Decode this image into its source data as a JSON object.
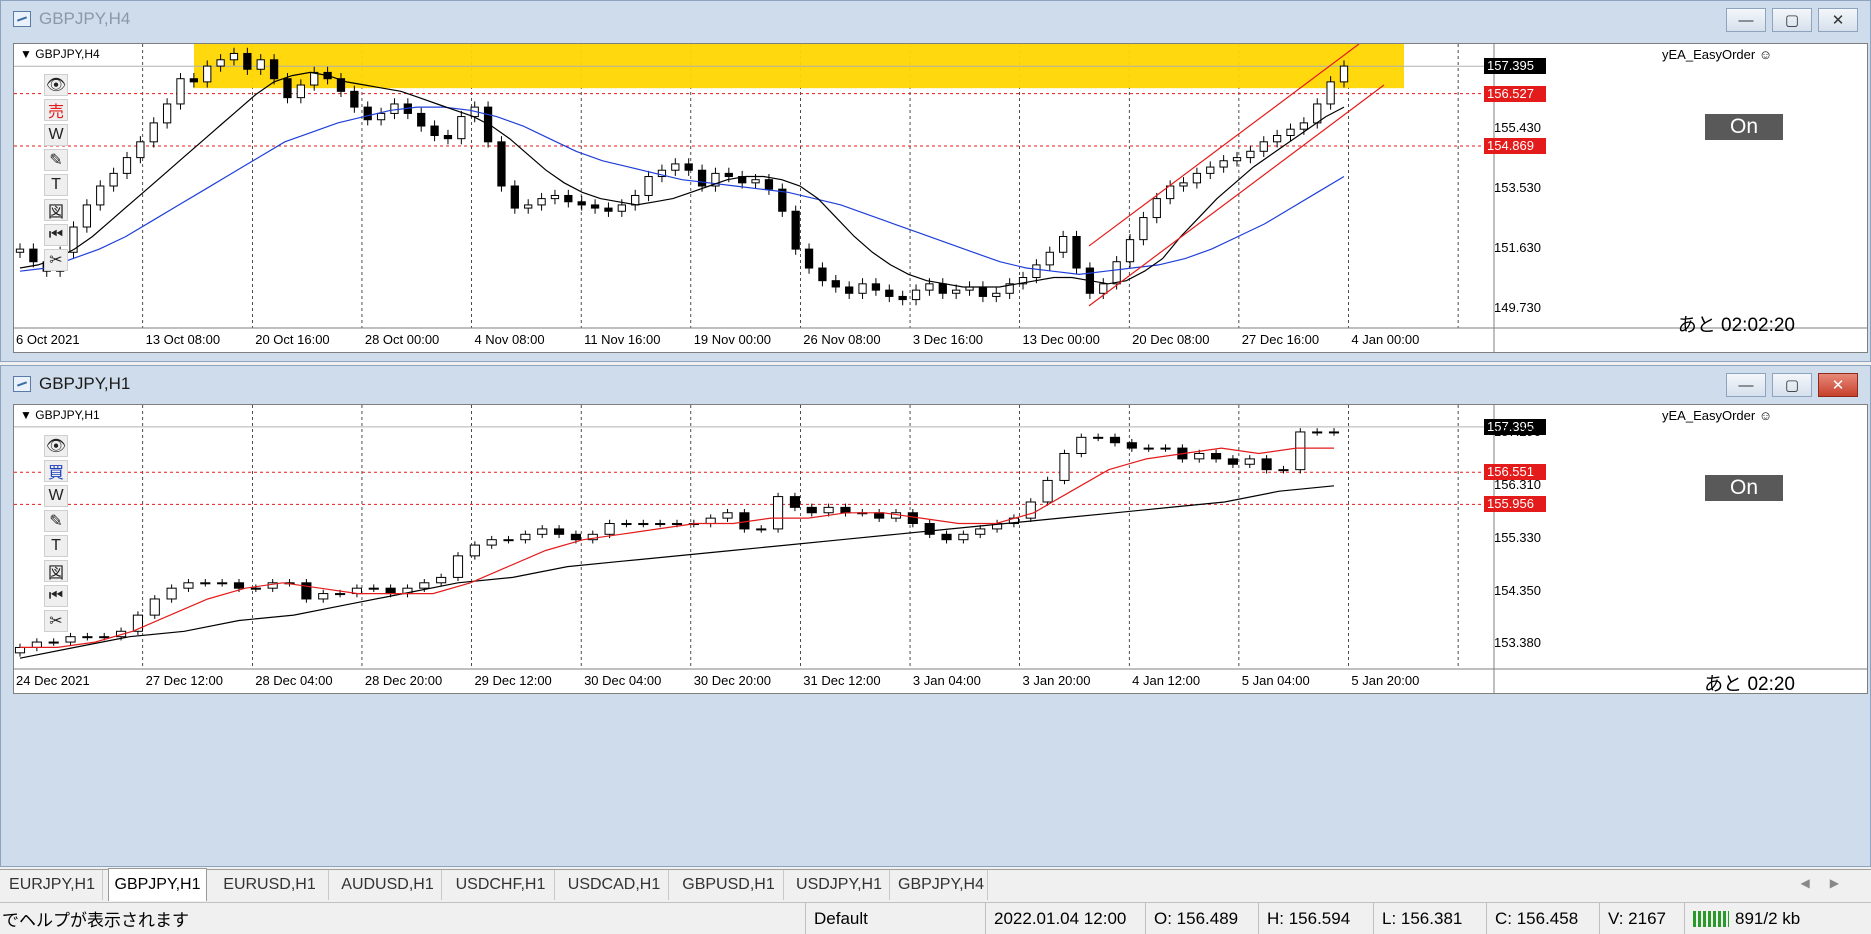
{
  "windows": [
    {
      "id": "h4",
      "title": "GBPJPY,H4",
      "symbol_label": "GBPJPY,H4",
      "ea_label": "yEA_EasyOrder",
      "order_tool_label": "売",
      "order_tool_color": "#e31b1b",
      "on_label": "On",
      "countdown": "あと 02:02:20",
      "price_labels": [
        "157.395",
        "156.527",
        "155.430",
        "154.869",
        "153.530",
        "151.630",
        "149.730"
      ],
      "current_price": "157.395",
      "red_lines": [
        "156.527",
        "154.869"
      ],
      "time_labels": [
        "6 Oct 2021",
        "13 Oct 08:00",
        "20 Oct 16:00",
        "28 Oct 00:00",
        "4 Nov 08:00",
        "11 Nov 16:00",
        "19 Nov 00:00",
        "26 Nov 08:00",
        "3 Dec 16:00",
        "13 Dec 00:00",
        "20 Dec 08:00",
        "27 Dec 16:00",
        "4 Jan 00:00"
      ],
      "chart_data": {
        "type": "candlestick",
        "ylim": [
          149.1,
          158.1
        ],
        "close": [
          151.6,
          151.2,
          150.9,
          151.5,
          152.3,
          153.0,
          153.6,
          154.0,
          154.5,
          155.0,
          155.6,
          156.2,
          157.0,
          156.9,
          157.4,
          157.6,
          157.8,
          157.3,
          157.6,
          157.0,
          156.4,
          156.8,
          157.2,
          157.0,
          156.6,
          156.1,
          155.7,
          155.9,
          156.2,
          155.9,
          155.5,
          155.2,
          155.1,
          155.8,
          156.1,
          155.0,
          153.6,
          152.9,
          153.0,
          153.2,
          153.3,
          153.1,
          153.0,
          152.9,
          152.8,
          153.0,
          153.3,
          153.9,
          154.1,
          154.3,
          154.1,
          153.6,
          154.0,
          153.9,
          153.7,
          153.8,
          153.5,
          152.8,
          151.6,
          151.0,
          150.6,
          150.4,
          150.2,
          150.5,
          150.3,
          150.1,
          150.0,
          150.3,
          150.5,
          150.2,
          150.3,
          150.4,
          150.1,
          150.2,
          150.5,
          150.7,
          151.1,
          151.5,
          152.0,
          151.0,
          150.2,
          150.5,
          151.2,
          151.9,
          152.6,
          153.2,
          153.6,
          153.7,
          154.0,
          154.2,
          154.4,
          154.5,
          154.7,
          155.0,
          155.2,
          155.4,
          155.6,
          156.2,
          156.9,
          157.4
        ],
        "ma_short": [
          151.0,
          151.1,
          151.3,
          151.6,
          152.0,
          152.5,
          153.0,
          153.5,
          154.0,
          154.5,
          155.0,
          155.5,
          156.0,
          156.5,
          156.9,
          157.1,
          157.2,
          157.1,
          156.9,
          156.8,
          156.7,
          156.6,
          156.4,
          156.2,
          156.0,
          155.8,
          155.5,
          155.1,
          154.6,
          154.1,
          153.7,
          153.4,
          153.2,
          153.1,
          153.0,
          153.1,
          153.2,
          153.4,
          153.6,
          153.8,
          153.9,
          153.9,
          153.8,
          153.6,
          153.2,
          152.6,
          152.0,
          151.5,
          151.1,
          150.8,
          150.6,
          150.5,
          150.4,
          150.4,
          150.4,
          150.5,
          150.6,
          150.7,
          150.7,
          150.6,
          150.5,
          150.6,
          150.9,
          151.3,
          152.0,
          152.6,
          153.2,
          153.7,
          154.2,
          154.6,
          155.0,
          155.4,
          155.8,
          156.1
        ],
        "ma_long": [
          150.9,
          151.0,
          151.3,
          151.6,
          152.0,
          152.5,
          153.0,
          153.5,
          154.0,
          154.5,
          155.0,
          155.3,
          155.6,
          155.8,
          156.0,
          156.1,
          156.1,
          156.0,
          155.8,
          155.5,
          155.1,
          154.7,
          154.4,
          154.2,
          154.0,
          153.8,
          153.7,
          153.6,
          153.5,
          153.4,
          153.2,
          153.0,
          152.7,
          152.4,
          152.1,
          151.8,
          151.5,
          151.2,
          151.0,
          150.9,
          150.8,
          150.9,
          151.0,
          151.1,
          151.3,
          151.6,
          152.0,
          152.4,
          152.9,
          153.4,
          153.9
        ]
      }
    },
    {
      "id": "h1",
      "title": "GBPJPY,H1",
      "symbol_label": "GBPJPY,H1",
      "ea_label": "yEA_EasyOrder",
      "order_tool_label": "買",
      "order_tool_color": "#1f3fbf",
      "on_label": "On",
      "countdown": "あと 02:20",
      "price_labels": [
        "157.395",
        "157.290",
        "156.551",
        "156.310",
        "155.956",
        "155.330",
        "154.350",
        "153.380"
      ],
      "current_price": "157.395",
      "red_lines": [
        "156.551",
        "155.956"
      ],
      "time_labels": [
        "24 Dec 2021",
        "27 Dec 12:00",
        "28 Dec 04:00",
        "28 Dec 20:00",
        "29 Dec 12:00",
        "30 Dec 04:00",
        "30 Dec 20:00",
        "31 Dec 12:00",
        "3 Jan 04:00",
        "3 Jan 20:00",
        "4 Jan 12:00",
        "5 Jan 04:00",
        "5 Jan 20:00"
      ],
      "chart_data": {
        "type": "candlestick",
        "ylim": [
          152.9,
          157.8
        ],
        "close": [
          153.3,
          153.4,
          153.4,
          153.5,
          153.5,
          153.5,
          153.6,
          153.9,
          154.2,
          154.4,
          154.5,
          154.5,
          154.5,
          154.4,
          154.4,
          154.5,
          154.5,
          154.2,
          154.3,
          154.3,
          154.4,
          154.4,
          154.3,
          154.4,
          154.5,
          154.6,
          155.0,
          155.2,
          155.3,
          155.3,
          155.4,
          155.5,
          155.4,
          155.3,
          155.4,
          155.6,
          155.6,
          155.6,
          155.6,
          155.6,
          155.6,
          155.7,
          155.8,
          155.5,
          155.5,
          156.1,
          155.9,
          155.8,
          155.9,
          155.8,
          155.8,
          155.7,
          155.8,
          155.6,
          155.4,
          155.3,
          155.4,
          155.5,
          155.6,
          155.7,
          156.0,
          156.4,
          156.9,
          157.2,
          157.2,
          157.1,
          157.0,
          157.0,
          157.0,
          156.8,
          156.9,
          156.8,
          156.7,
          156.8,
          156.6,
          156.6,
          157.3,
          157.3,
          157.3
        ],
        "ma_short": [
          153.3,
          153.3,
          153.4,
          153.6,
          153.9,
          154.2,
          154.4,
          154.5,
          154.4,
          154.3,
          154.3,
          154.3,
          154.5,
          154.8,
          155.1,
          155.3,
          155.4,
          155.5,
          155.6,
          155.6,
          155.7,
          155.7,
          155.8,
          155.8,
          155.7,
          155.6,
          155.6,
          155.8,
          156.2,
          156.6,
          156.8,
          156.9,
          157.0,
          156.9,
          157.0,
          157.0
        ],
        "ma_long": [
          153.1,
          153.3,
          153.5,
          153.6,
          153.8,
          153.9,
          154.1,
          154.3,
          154.5,
          154.6,
          154.8,
          154.9,
          155.0,
          155.1,
          155.2,
          155.3,
          155.4,
          155.5,
          155.6,
          155.7,
          155.8,
          155.9,
          156.0,
          156.2,
          156.3
        ]
      }
    }
  ],
  "tabs": [
    {
      "label": "EURJPY,H1",
      "active": false
    },
    {
      "label": "GBPJPY,H1",
      "active": true
    },
    {
      "label": "EURUSD,H1",
      "active": false
    },
    {
      "label": "AUDUSD,H1",
      "active": false
    },
    {
      "label": "USDCHF,H1",
      "active": false
    },
    {
      "label": "USDCAD,H1",
      "active": false
    },
    {
      "label": "GBPUSD,H1",
      "active": false
    },
    {
      "label": "USDJPY,H1",
      "active": false
    },
    {
      "label": "GBPJPY,H4",
      "active": false
    }
  ],
  "status": {
    "help": "でヘルプが表示されます",
    "profile": "Default",
    "datetime": "2022.01.04 12:00",
    "open": "O: 156.489",
    "high": "H: 156.594",
    "low": "L: 156.381",
    "close": "C: 156.458",
    "volume": "V: 2167",
    "traffic": "891/2 kb"
  },
  "colors": {
    "ma_h4_short": "#000000",
    "ma_h4_long": "#1f3fd9",
    "ma_h1_short": "#e31b1b",
    "ma_h1_long": "#000000",
    "channel": "#e31b1b",
    "zone": "#ffd700"
  }
}
